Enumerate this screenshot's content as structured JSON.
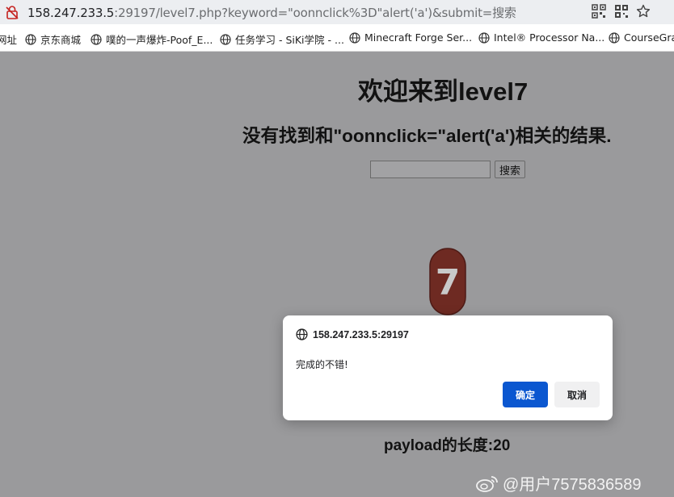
{
  "address_bar": {
    "host": "158.247.233.5",
    "rest": ":29197/level7.php?keyword=\"oonnclick%3D\"alert('a')&submit=搜索",
    "icons": [
      "insecure-lock-icon",
      "qr-code-icon",
      "qr-scan-icon",
      "bookmark-star-icon"
    ]
  },
  "bookmarks": [
    {
      "label": "网址",
      "icon": ""
    },
    {
      "label": "京东商城",
      "icon": "globe-icon"
    },
    {
      "label": "噗的一声爆炸-Poof_E...",
      "icon": "globe-icon"
    },
    {
      "label": "任务学习 - SiKi学院 - ...",
      "icon": "globe-icon"
    },
    {
      "label": "Minecraft Forge Ser...",
      "icon": "globe-icon"
    },
    {
      "label": "Intel® Processor Na...",
      "icon": "globe-icon"
    },
    {
      "label": "CourseGrad",
      "icon": "globe-icon"
    }
  ],
  "page": {
    "title": "欢迎来到level7",
    "result": "没有找到和\"oonnclick=\"alert('a')相关的结果.",
    "search_value": "",
    "search_button": "搜索",
    "badge_number": "7",
    "payload_text": "payload的长度:20"
  },
  "dialog": {
    "origin": "158.247.233.5:29197",
    "message": "完成的不错!",
    "ok_label": "确定",
    "cancel_label": "取消"
  },
  "watermark": {
    "text": "@用户7575836589",
    "icon": "weibo-icon"
  },
  "colors": {
    "page_bg": "#9a9a9c",
    "ok_button": "#0b57d0",
    "badge": "#6e2a22"
  }
}
